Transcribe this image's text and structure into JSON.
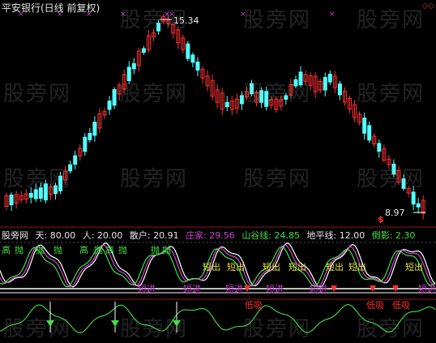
{
  "title": "平安银行(日线 前复权)",
  "right_controls": "◇◇",
  "price_high_label": "15.34",
  "price_low_label": "8.97",
  "dollar_marker": "$",
  "watermark": "股旁网",
  "indicator": {
    "site": "股旁网",
    "items": [
      {
        "label": "天: 80.00",
        "color": "#e6e6e6"
      },
      {
        "label": "人: 20.00",
        "color": "#e6e6e6"
      },
      {
        "label": "散户: 20.91",
        "color": "#e6e6e6"
      },
      {
        "label": "庄家: 29.56",
        "color": "#d040d0"
      },
      {
        "label": "山谷线: 24.85",
        "color": "#40e040"
      },
      {
        "label": "地平线: 12.00",
        "color": "#e6e6e6"
      },
      {
        "label": "倒影: 2.30",
        "color": "#40e040"
      }
    ]
  },
  "signals": {
    "gao": "高",
    "pao": "抛",
    "duan_chu": "短出",
    "duan_jin": "短进",
    "di_xi": "低吸"
  },
  "colors": {
    "up": "#ff3030",
    "down": "#54ffff",
    "green": "#40e040",
    "yellow": "#e0e040",
    "magenta": "#d040d0"
  }
}
